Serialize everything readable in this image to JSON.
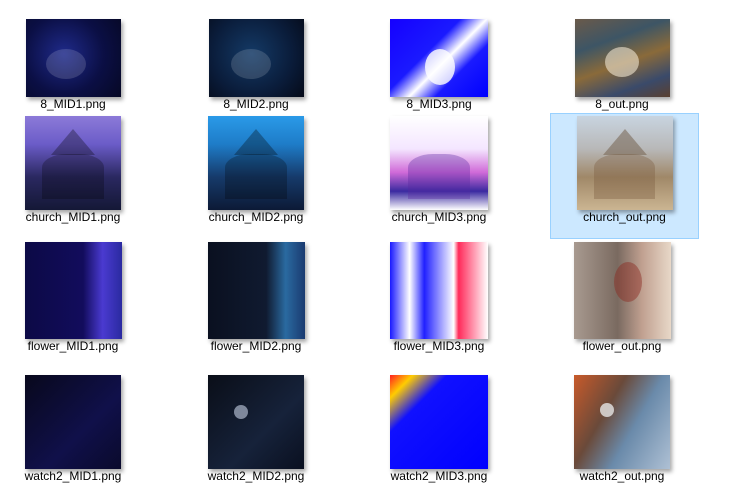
{
  "files": [
    {
      "name": "8_MID1.png",
      "look": "mid1"
    },
    {
      "name": "8_MID2.png",
      "look": "mid2"
    },
    {
      "name": "8_MID3.png",
      "look": "mid3"
    },
    {
      "name": "8_out.png",
      "look": "out8"
    },
    {
      "name": "church_MID1.png",
      "look": "church1"
    },
    {
      "name": "church_MID2.png",
      "look": "church2"
    },
    {
      "name": "church_MID3.png",
      "look": "church3"
    },
    {
      "name": "church_out.png",
      "look": "churchOut",
      "selected": true
    },
    {
      "name": "flower_MID1.png",
      "look": "flower1"
    },
    {
      "name": "flower_MID2.png",
      "look": "flower2"
    },
    {
      "name": "flower_MID3.png",
      "look": "flower3"
    },
    {
      "name": "flower_out.png",
      "look": "flowerOut"
    },
    {
      "name": "watch2_MID1.png",
      "look": "watch1"
    },
    {
      "name": "watch2_MID2.png",
      "look": "watch2"
    },
    {
      "name": "watch2_MID3.png",
      "look": "watch3"
    },
    {
      "name": "watch2_out.png",
      "look": "watchOut"
    }
  ]
}
